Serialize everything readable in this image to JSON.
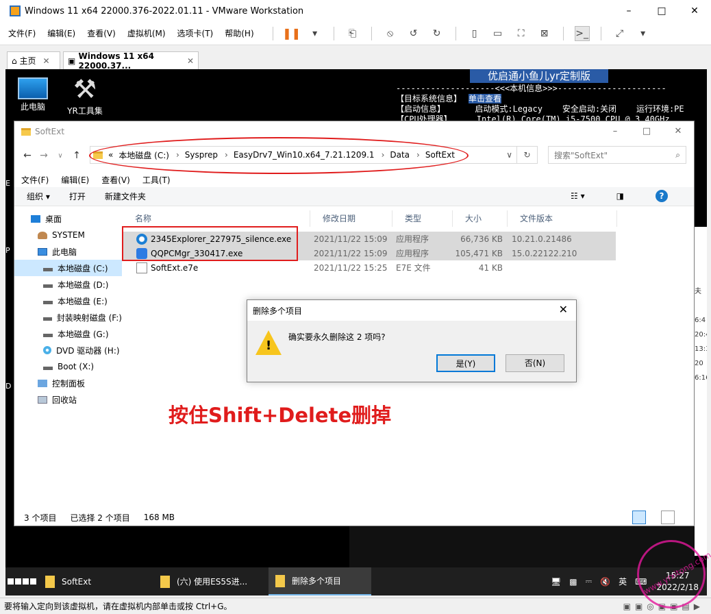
{
  "vmware": {
    "title": "Windows 11 x64 22000.376-2022.01.11 - VMware Workstation",
    "menu": [
      "文件(F)",
      "编辑(E)",
      "查看(V)",
      "虚拟机(M)",
      "选项卡(T)",
      "帮助(H)"
    ],
    "tabs": [
      {
        "label": "主页"
      },
      {
        "label": "Windows 11 x64 22000.37..."
      }
    ],
    "status_text": "要将输入定向到该虚拟机，请在虚拟机内部单击或按 Ctrl+G。"
  },
  "desktop": {
    "icons": [
      {
        "label": "此电脑"
      },
      {
        "label": "YR工具集"
      }
    ],
    "banner": "优启通小鱼儿yr定制版",
    "console_lines": {
      "line1": "--------------------<<<本机信息>>>----------------------",
      "line2_a": "【目标系统信息】",
      "line2_b": "单击查看",
      "line3": "【启动信息】      启动模式:Legacy    安全启动:关闭    运行环境:PE",
      "line4": "【CPU处理器】     Intel(R) Core(TM) i5-7500 CPU @ 3.40GHz"
    },
    "left_edge_letters": [
      "E",
      "P",
      "D"
    ],
    "right_strip": [
      "",
      "",
      "",
      "",
      "夫",
      "",
      "6:4",
      "20:4",
      "13:3",
      "20",
      "6:16"
    ]
  },
  "explorer": {
    "title": "SoftExt",
    "address": {
      "prefix": "«",
      "segments": [
        "本地磁盘 (C:)",
        "Sysprep",
        "EasyDrv7_Win10.x64_7.21.1209.1",
        "Data",
        "SoftExt"
      ]
    },
    "search_placeholder": "搜索\"SoftExt\"",
    "menu": [
      "文件(F)",
      "编辑(E)",
      "查看(V)",
      "工具(T)"
    ],
    "commands": [
      "组织 ▾",
      "打开",
      "新建文件夹"
    ],
    "nav_items": [
      {
        "label": "桌面",
        "icon": "desktop"
      },
      {
        "label": "SYSTEM",
        "icon": "user"
      },
      {
        "label": "此电脑",
        "icon": "pc"
      },
      {
        "label": "本地磁盘 (C:)",
        "icon": "disk"
      },
      {
        "label": "本地磁盘 (D:)",
        "icon": "disk"
      },
      {
        "label": "本地磁盘 (E:)",
        "icon": "disk"
      },
      {
        "label": "封装映射磁盘 (F:)",
        "icon": "disk"
      },
      {
        "label": "本地磁盘 (G:)",
        "icon": "disk"
      },
      {
        "label": "DVD 驱动器 (H:)",
        "icon": "dvd"
      },
      {
        "label": "Boot (X:)",
        "icon": "disk"
      },
      {
        "label": "控制面板",
        "icon": "control-panel"
      },
      {
        "label": "回收站",
        "icon": "recycle-bin"
      }
    ],
    "columns": [
      "名称",
      "修改日期",
      "类型",
      "大小",
      "文件版本"
    ],
    "files": [
      {
        "name": "2345Explorer_227975_silence.exe",
        "date": "2021/11/22 15:09",
        "type": "应用程序",
        "size": "66,736 KB",
        "version": "10.21.0.21486"
      },
      {
        "name": "QQPCMgr_330417.exe",
        "date": "2021/11/22 15:09",
        "type": "应用程序",
        "size": "105,471 KB",
        "version": "15.0.22122.210"
      },
      {
        "name": "SoftExt.e7e",
        "date": "2021/11/22 15:25",
        "type": "E7E 文件",
        "size": "41 KB",
        "version": ""
      }
    ],
    "status": {
      "count": "3 个项目",
      "selected": "已选择 2 个项目",
      "size": "168 MB"
    }
  },
  "dialog": {
    "title": "删除多个项目",
    "message": "确实要永久删除这 2 项吗?",
    "yes": "是(Y)",
    "no": "否(N)"
  },
  "annotation": "按住Shift+Delete删掉",
  "taskbar": {
    "items": [
      "SoftExt",
      "(六) 使用ES5S进...",
      "删除多个项目"
    ],
    "ime": "英",
    "time": "15:27",
    "date": "2022/2/18"
  },
  "watermark": "www.yrxitong.com",
  "colors": {
    "annotation_red": "#e01c1c",
    "selection_blue": "#cce8ff",
    "accent": "#0078d7"
  }
}
